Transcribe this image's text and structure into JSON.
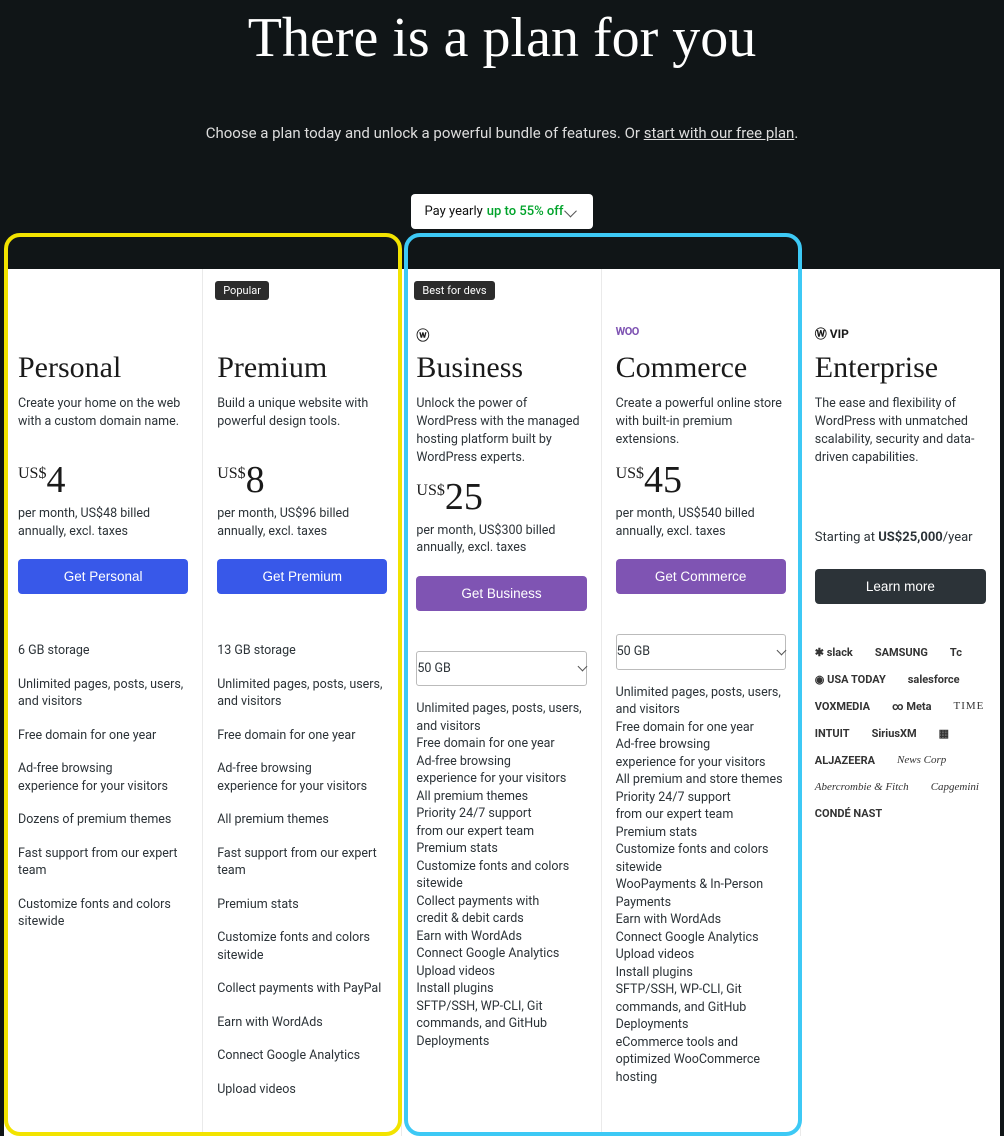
{
  "hero": {
    "title": "There is a plan for you",
    "sub_pre": "Choose a plan today and unlock a powerful bundle of features. Or ",
    "sub_link": "start with our free plan",
    "sub_post": "."
  },
  "toggle": {
    "label": "Pay yearly",
    "discount": "up to 55% off"
  },
  "plans": {
    "personal": {
      "name": "Personal",
      "desc": "Create your home on the web with a custom domain name.",
      "cur": "US$",
      "amt": "4",
      "note": "per month, US$48 billed annually, excl. taxes",
      "cta": "Get Personal",
      "features": [
        "6 GB storage",
        "Unlimited pages, posts, users, and visitors",
        "Free domain for one year",
        "Ad-free browsing\nexperience for your visitors",
        "Dozens of premium themes",
        "Fast support from our expert team",
        "Customize fonts and colors sitewide"
      ]
    },
    "premium": {
      "badge": "Popular",
      "name": "Premium",
      "desc": "Build a unique website with powerful design tools.",
      "cur": "US$",
      "amt": "8",
      "note": "per month, US$96 billed annually, excl. taxes",
      "cta": "Get Premium",
      "features": [
        "13 GB storage",
        "Unlimited pages, posts, users, and visitors",
        "Free domain for one year",
        "Ad-free browsing\nexperience for your visitors",
        "All premium themes",
        "Fast support from our expert team",
        "Premium stats",
        "Customize fonts and colors sitewide",
        "Collect payments with PayPal",
        "Earn with WordAds",
        "Connect Google Analytics",
        "Upload videos"
      ]
    },
    "business": {
      "badge": "Best for devs",
      "name": "Business",
      "desc": "Unlock the power of WordPress with the managed hosting platform built by WordPress experts.",
      "cur": "US$",
      "amt": "25",
      "note": "per month, US$300 billed annually, excl. taxes",
      "cta": "Get Business",
      "storage": "50 GB",
      "features": [
        "Unlimited pages, posts, users, and visitors",
        "Free domain for one year",
        "Ad-free browsing\nexperience for your visitors",
        "All premium themes",
        "Priority 24/7 support\nfrom our expert team",
        "Premium stats",
        "Customize fonts and colors sitewide",
        "Collect payments with\ncredit & debit cards",
        "Earn with WordAds",
        "Connect Google Analytics",
        "Upload videos",
        "Install plugins",
        "SFTP/SSH, WP-CLI, Git commands, and GitHub Deployments"
      ]
    },
    "commerce": {
      "name": "Commerce",
      "desc": "Create a powerful online store with built-in premium extensions.",
      "cur": "US$",
      "amt": "45",
      "note": "per month, US$540 billed annually, excl. taxes",
      "cta": "Get Commerce",
      "storage": "50 GB",
      "features": [
        "Unlimited pages, posts, users, and visitors",
        "Free domain for one year",
        "Ad-free browsing\nexperience for your visitors",
        "All premium and store themes",
        "Priority 24/7 support\nfrom our expert team",
        "Premium stats",
        "Customize fonts and colors sitewide",
        "WooPayments & In-Person Payments",
        "Earn with WordAds",
        "Connect Google Analytics",
        "Upload videos",
        "Install plugins",
        "SFTP/SSH, WP-CLI, Git commands, and GitHub Deployments",
        "eCommerce tools and optimized WooCommerce hosting"
      ]
    },
    "enterprise": {
      "name": "Enterprise",
      "desc": "The ease and flexibility of WordPress with unmatched scalability, security and data-driven capabilities.",
      "starting_pre": "Starting at ",
      "starting_price": "US$25,000",
      "starting_post": "/year",
      "cta": "Learn more",
      "icon_label": "Ⓦ VIP",
      "logos": [
        "slack",
        "SAMSUNG",
        "Tc",
        "USA TODAY",
        "salesforce",
        "VOXMEDIA",
        "Meta",
        "TIME",
        "INTUIT",
        "SiriusXM",
        "▦",
        "ALJAZEERA",
        "News Corp",
        "Abercrombie & Fitch",
        "Capgemini",
        "CONDÉ NAST"
      ]
    }
  }
}
